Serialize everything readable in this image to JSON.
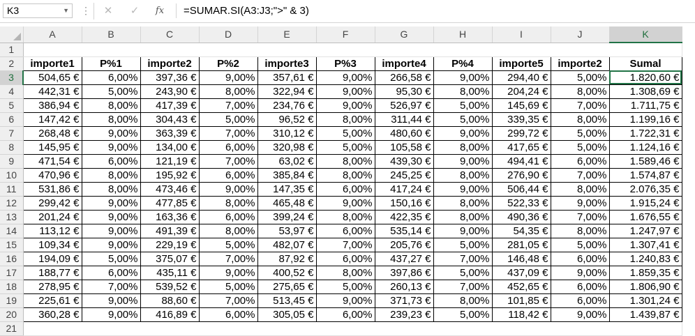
{
  "formula_bar": {
    "name_box": "K3",
    "cancel_icon": "✕",
    "enter_icon": "✓",
    "fx_label": "fx",
    "formula": "=SUMAR.SI(A3:J3;\">\" &  3)"
  },
  "sheet": {
    "columns": [
      "A",
      "B",
      "C",
      "D",
      "E",
      "F",
      "G",
      "H",
      "I",
      "J",
      "K"
    ],
    "selected_column": "K",
    "selected_row": "3",
    "row1_label": "1",
    "row21_label": "21",
    "header_row_label": "2",
    "headers": [
      "importe1",
      "P%1",
      "importe2",
      "P%2",
      "importe3",
      "P%3",
      "importe4",
      "P%4",
      "importe5",
      "importe2",
      "Sumal"
    ],
    "rows": [
      {
        "n": "3",
        "cells": [
          "504,65 €",
          "6,00%",
          "397,36 €",
          "9,00%",
          "357,61 €",
          "9,00%",
          "266,58 €",
          "9,00%",
          "294,40 €",
          "5,00%",
          "1.820,60 €"
        ]
      },
      {
        "n": "4",
        "cells": [
          "442,31 €",
          "5,00%",
          "243,90 €",
          "8,00%",
          "322,94 €",
          "9,00%",
          "95,30 €",
          "8,00%",
          "204,24 €",
          "8,00%",
          "1.308,69 €"
        ]
      },
      {
        "n": "5",
        "cells": [
          "386,94 €",
          "8,00%",
          "417,39 €",
          "7,00%",
          "234,76 €",
          "9,00%",
          "526,97 €",
          "5,00%",
          "145,69 €",
          "7,00%",
          "1.711,75 €"
        ]
      },
      {
        "n": "6",
        "cells": [
          "147,42 €",
          "8,00%",
          "304,43 €",
          "5,00%",
          "96,52 €",
          "8,00%",
          "311,44 €",
          "5,00%",
          "339,35 €",
          "8,00%",
          "1.199,16 €"
        ]
      },
      {
        "n": "7",
        "cells": [
          "268,48 €",
          "9,00%",
          "363,39 €",
          "7,00%",
          "310,12 €",
          "5,00%",
          "480,60 €",
          "9,00%",
          "299,72 €",
          "5,00%",
          "1.722,31 €"
        ]
      },
      {
        "n": "8",
        "cells": [
          "145,95 €",
          "9,00%",
          "134,00 €",
          "6,00%",
          "320,98 €",
          "5,00%",
          "105,58 €",
          "8,00%",
          "417,65 €",
          "5,00%",
          "1.124,16 €"
        ]
      },
      {
        "n": "9",
        "cells": [
          "471,54 €",
          "6,00%",
          "121,19 €",
          "7,00%",
          "63,02 €",
          "8,00%",
          "439,30 €",
          "9,00%",
          "494,41 €",
          "6,00%",
          "1.589,46 €"
        ]
      },
      {
        "n": "10",
        "cells": [
          "470,96 €",
          "8,00%",
          "195,92 €",
          "6,00%",
          "385,84 €",
          "8,00%",
          "245,25 €",
          "8,00%",
          "276,90 €",
          "7,00%",
          "1.574,87 €"
        ]
      },
      {
        "n": "11",
        "cells": [
          "531,86 €",
          "8,00%",
          "473,46 €",
          "9,00%",
          "147,35 €",
          "6,00%",
          "417,24 €",
          "9,00%",
          "506,44 €",
          "8,00%",
          "2.076,35 €"
        ]
      },
      {
        "n": "12",
        "cells": [
          "299,42 €",
          "9,00%",
          "477,85 €",
          "8,00%",
          "465,48 €",
          "9,00%",
          "150,16 €",
          "8,00%",
          "522,33 €",
          "9,00%",
          "1.915,24 €"
        ]
      },
      {
        "n": "13",
        "cells": [
          "201,24 €",
          "9,00%",
          "163,36 €",
          "6,00%",
          "399,24 €",
          "8,00%",
          "422,35 €",
          "8,00%",
          "490,36 €",
          "7,00%",
          "1.676,55 €"
        ]
      },
      {
        "n": "14",
        "cells": [
          "113,12 €",
          "9,00%",
          "491,39 €",
          "8,00%",
          "53,97 €",
          "6,00%",
          "535,14 €",
          "9,00%",
          "54,35 €",
          "8,00%",
          "1.247,97 €"
        ]
      },
      {
        "n": "15",
        "cells": [
          "109,34 €",
          "9,00%",
          "229,19 €",
          "5,00%",
          "482,07 €",
          "7,00%",
          "205,76 €",
          "5,00%",
          "281,05 €",
          "5,00%",
          "1.307,41 €"
        ]
      },
      {
        "n": "16",
        "cells": [
          "194,09 €",
          "5,00%",
          "375,07 €",
          "7,00%",
          "87,92 €",
          "6,00%",
          "437,27 €",
          "7,00%",
          "146,48 €",
          "6,00%",
          "1.240,83 €"
        ]
      },
      {
        "n": "17",
        "cells": [
          "188,77 €",
          "6,00%",
          "435,11 €",
          "9,00%",
          "400,52 €",
          "8,00%",
          "397,86 €",
          "5,00%",
          "437,09 €",
          "9,00%",
          "1.859,35 €"
        ]
      },
      {
        "n": "18",
        "cells": [
          "278,95 €",
          "7,00%",
          "539,52 €",
          "5,00%",
          "275,65 €",
          "5,00%",
          "260,13 €",
          "7,00%",
          "452,65 €",
          "6,00%",
          "1.806,90 €"
        ]
      },
      {
        "n": "19",
        "cells": [
          "225,61 €",
          "9,00%",
          "88,60 €",
          "7,00%",
          "513,45 €",
          "9,00%",
          "371,73 €",
          "8,00%",
          "101,85 €",
          "6,00%",
          "1.301,24 €"
        ]
      },
      {
        "n": "20",
        "cells": [
          "360,28 €",
          "9,00%",
          "416,89 €",
          "6,00%",
          "305,05 €",
          "6,00%",
          "239,23 €",
          "5,00%",
          "118,42 €",
          "9,00%",
          "1.439,87 €"
        ]
      }
    ]
  }
}
